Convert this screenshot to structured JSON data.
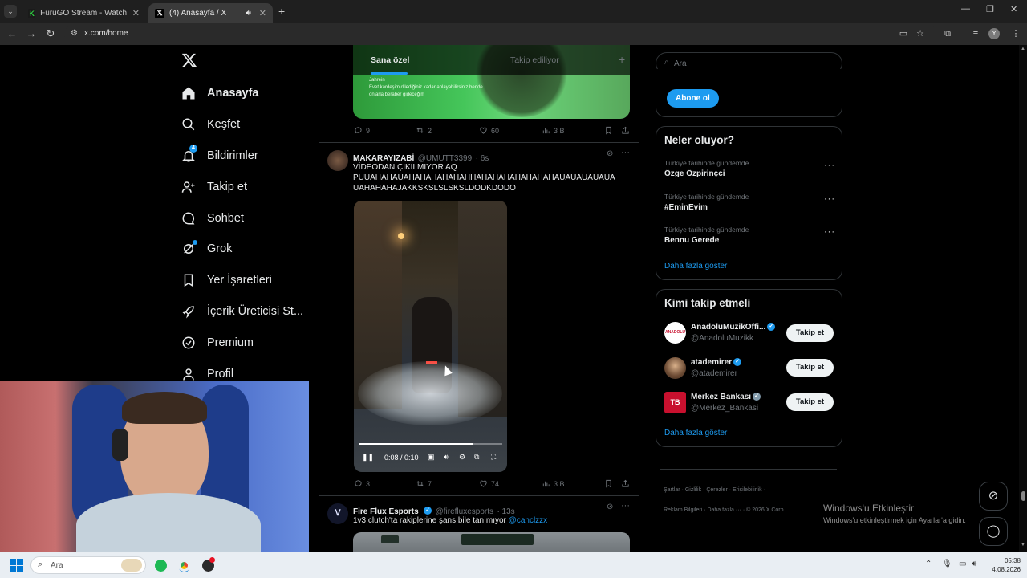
{
  "browser": {
    "tabs": [
      {
        "title": "FuruGO Stream - Watch Live on",
        "active": false
      },
      {
        "title": "(4) Anasayfa / X",
        "active": true
      }
    ],
    "url": "x.com/home",
    "profile_initial": "Y"
  },
  "nav": {
    "items": [
      {
        "label": "Anasayfa",
        "icon": "home-icon"
      },
      {
        "label": "Keşfet",
        "icon": "search-icon"
      },
      {
        "label": "Bildirimler",
        "icon": "bell-icon",
        "badge": "4"
      },
      {
        "label": "Takip et",
        "icon": "person-add-icon"
      },
      {
        "label": "Sohbet",
        "icon": "chat-bubble-icon"
      },
      {
        "label": "Grok",
        "icon": "grok-icon"
      },
      {
        "label": "Yer İşaretleri",
        "icon": "bookmark-icon"
      },
      {
        "label": "İçerik Üreticisi St...",
        "icon": "rocket-icon"
      },
      {
        "label": "Premium",
        "icon": "verified-badge-icon"
      },
      {
        "label": "Profil",
        "icon": "person-icon"
      }
    ]
  },
  "feed": {
    "tabs": {
      "for_you": "Sana özel",
      "following": "Takip ediliyor",
      "add": "+"
    },
    "top_tweet": {
      "image_text_1": "Jahrein",
      "image_text_2": "Evet kardeşim dilediğiniz kadar anlayabilirsiniz bende",
      "image_text_3": "onlarla beraber gideceğim",
      "replies": "9",
      "reposts": "2",
      "likes": "60",
      "views": "3 B"
    },
    "tweet1": {
      "name": "MAKARAYIZABİ",
      "handle": "@UMUTT3399",
      "time": "· 6s",
      "text1": "VİDEODAN ÇIKILMIYOR AQ",
      "text2": "PUUAHAHAUAHAHAHAHAHAHHAHAHAHAHAHAHAHAUAUAUAUAUA",
      "text3": "UAHAHAHAJAKKSKSLSLSKSLDODKDODO",
      "video_time": "0:08 / 0:10",
      "video_progress": 0.8,
      "replies": "3",
      "reposts": "7",
      "likes": "74",
      "views": "3 B"
    },
    "tweet2": {
      "name": "Fire Flux Esports",
      "handle": "@firefluxesports",
      "time": "· 13s",
      "text": "1v3 clutch'ta rakiplerine şans bile tanımıyor",
      "mention": "@canclzzx"
    }
  },
  "sidebar": {
    "search_placeholder": "Ara",
    "subscribe_label": "Abone ol",
    "trends_title": "Neler oluyor?",
    "trends": [
      {
        "category": "Türkiye tarihinde gündemde",
        "name": "Özge Özpirinçci"
      },
      {
        "category": "Türkiye tarihinde gündemde",
        "name": "#EminEvim"
      },
      {
        "category": "Türkiye tarihinde gündemde",
        "name": "Bennu Gerede"
      }
    ],
    "show_more": "Daha fazla göster",
    "who_to_follow_title": "Kimi takip etmeli",
    "suggestions": [
      {
        "name": "AnadoluMuzikOffi...",
        "handle": "@AnadoluMuzikk",
        "verified": "blue",
        "avatar_color": "#ffffff"
      },
      {
        "name": "atademirer",
        "handle": "@atademirer",
        "verified": "blue",
        "avatar_color": "#6b4a33"
      },
      {
        "name": "Merkez Bankası",
        "handle": "@Merkez_Bankasi",
        "verified": "grey",
        "avatar_color": "#c8102e"
      }
    ],
    "follow_label": "Takip et",
    "show_more_2": "Daha fazla göster",
    "footer_row1": [
      "Şartlar",
      "Gizlilik",
      "Çerezler",
      "Erişilebilirlik"
    ],
    "footer_row2": [
      "Reklam Bilgileri",
      "Daha fazla ···",
      "© 2026 X Corp."
    ]
  },
  "watermark": {
    "title": "Windows'u Etkinleştir",
    "subtitle": "Windows'u etkinleştirmek için Ayarlar'a gidin."
  },
  "taskbar": {
    "search_placeholder": "Ara",
    "time": "05:38",
    "date": "4.08.2026"
  },
  "colors": {
    "accent": "#1d9bf0",
    "text": "#e7e9ea",
    "muted": "#71767b",
    "border": "#2f3336"
  }
}
